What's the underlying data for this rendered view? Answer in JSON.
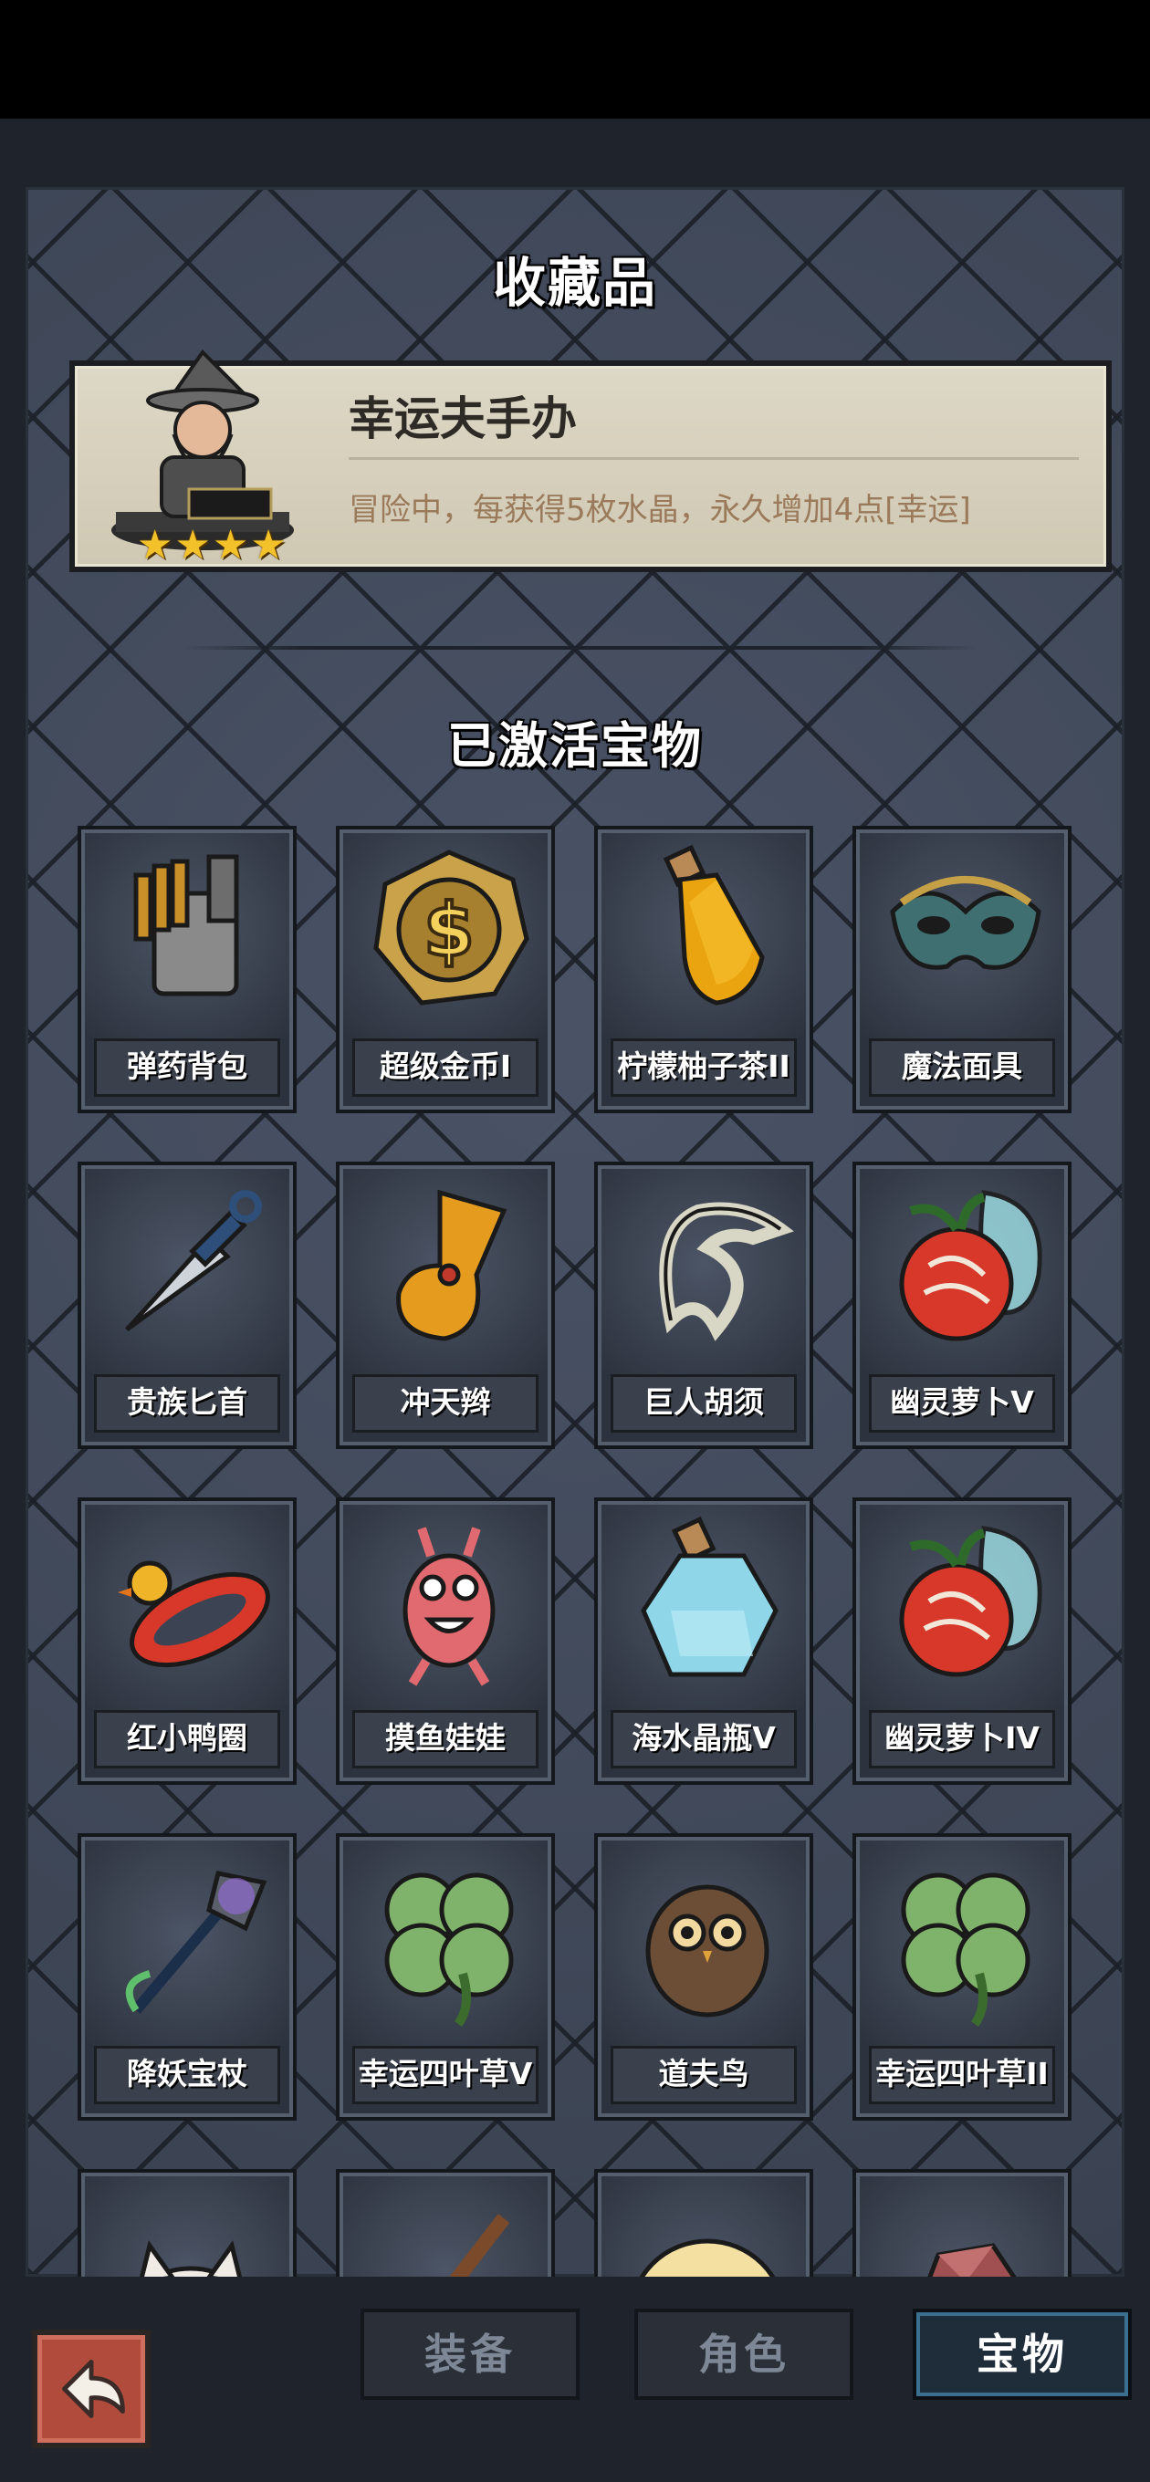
{
  "header": {
    "collection_title": "收藏品"
  },
  "collectible": {
    "name": "幸运夫手办",
    "description": "冒险中，每获得5枚水晶，永久增加4点[幸运]",
    "stars": 4
  },
  "active_section": {
    "title": "已激活宝物"
  },
  "treasures": [
    {
      "label": "弹药背包",
      "icon": "ammo-bag-icon"
    },
    {
      "label": "超级金币I",
      "icon": "gold-coin-icon"
    },
    {
      "label": "柠檬柚子茶II",
      "icon": "lemon-tea-bottle-icon"
    },
    {
      "label": "魔法面具",
      "icon": "magic-mask-icon"
    },
    {
      "label": "贵族匕首",
      "icon": "dagger-icon"
    },
    {
      "label": "冲天辫",
      "icon": "ponytail-icon"
    },
    {
      "label": "巨人胡须",
      "icon": "beard-icon"
    },
    {
      "label": "幽灵萝卜V",
      "icon": "ghost-radish-icon"
    },
    {
      "label": "红小鸭圈",
      "icon": "swim-ring-icon"
    },
    {
      "label": "摸鱼娃娃",
      "icon": "fish-doll-icon"
    },
    {
      "label": "海水晶瓶V",
      "icon": "crystal-bottle-icon"
    },
    {
      "label": "幽灵萝卜IV",
      "icon": "ghost-radish-icon"
    },
    {
      "label": "降妖宝杖",
      "icon": "staff-icon"
    },
    {
      "label": "幸运四叶草V",
      "icon": "clover-icon"
    },
    {
      "label": "道夫鸟",
      "icon": "owl-icon"
    },
    {
      "label": "幸运四叶草II",
      "icon": "clover-icon"
    }
  ],
  "partial_row": [
    {
      "icon": "lucky-cat-icon"
    },
    {
      "icon": "brush-icon"
    },
    {
      "icon": "donut-icon"
    },
    {
      "icon": "gem-rock-icon"
    }
  ],
  "bottom_nav": {
    "back_icon": "back-arrow-icon",
    "tabs": [
      {
        "label": "装备"
      },
      {
        "label": "角色"
      },
      {
        "label": "宝物"
      }
    ],
    "active_tab": "宝物"
  }
}
